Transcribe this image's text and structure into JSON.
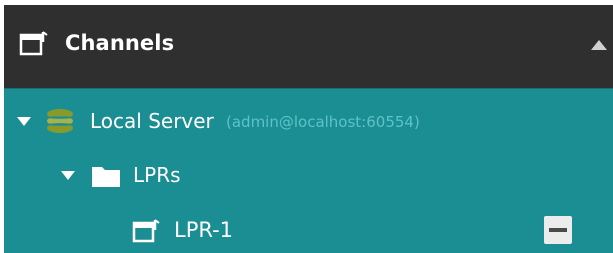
{
  "panel": {
    "title": "Channels",
    "header_icon": "camera-channel-icon",
    "collapse_icon": "collapse-up-icon"
  },
  "colors": {
    "header_bg": "#2f2f2f",
    "tree_bg": "#1b8e93",
    "server_icon": "#8a9a2a",
    "address_text": "#5dc3c6"
  },
  "tree": {
    "server": {
      "name": "Local Server",
      "address": "(admin@localhost:60554)",
      "icon": "server-stack-icon",
      "expanded": true
    },
    "folder": {
      "name": "LPRs",
      "icon": "folder-icon",
      "expanded": true
    },
    "channel": {
      "name": "LPR-1",
      "icon": "camera-channel-icon",
      "action_icon": "remove-icon"
    }
  }
}
